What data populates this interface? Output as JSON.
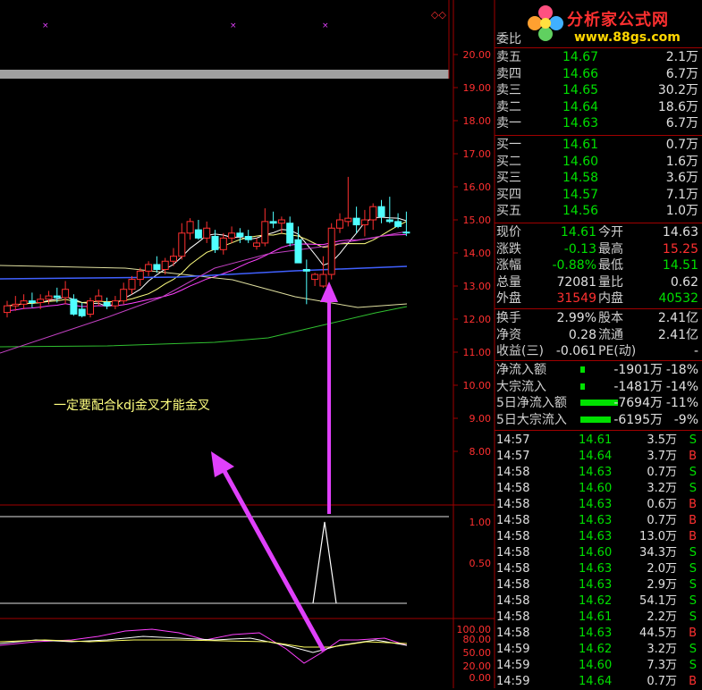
{
  "note": "一定要配合kdj金叉才能金叉",
  "logo": {
    "brand": "分析家公式网",
    "url": "www.88gs.com"
  },
  "price_axis": [
    "20.00",
    "19.00",
    "18.00",
    "17.00",
    "16.00",
    "15.00",
    "14.00",
    "13.00",
    "12.00",
    "11.00",
    "10.00",
    "9.00",
    "8.00"
  ],
  "ind1_axis": [
    "1.00",
    "0.50"
  ],
  "ind2_axis": [
    "100.00",
    "80.00",
    "50.00",
    "20.00",
    "0.00"
  ],
  "order_book": {
    "header": {
      "label": "委比",
      "value": ""
    },
    "asks": [
      {
        "label": "卖五",
        "price": "14.67",
        "vol": "2.1万"
      },
      {
        "label": "卖四",
        "price": "14.66",
        "vol": "6.7万"
      },
      {
        "label": "卖三",
        "price": "14.65",
        "vol": "30.2万"
      },
      {
        "label": "卖二",
        "price": "14.64",
        "vol": "18.6万"
      },
      {
        "label": "卖一",
        "price": "14.63",
        "vol": "6.7万"
      }
    ],
    "bids": [
      {
        "label": "买一",
        "price": "14.61",
        "vol": "0.7万"
      },
      {
        "label": "买二",
        "price": "14.60",
        "vol": "1.6万"
      },
      {
        "label": "买三",
        "price": "14.58",
        "vol": "3.6万"
      },
      {
        "label": "买四",
        "price": "14.57",
        "vol": "7.1万"
      },
      {
        "label": "买五",
        "price": "14.56",
        "vol": "1.0万"
      }
    ]
  },
  "quote": [
    {
      "l1": "现价",
      "v1": "14.61",
      "l2": "今开",
      "v2": "14.63"
    },
    {
      "l1": "涨跌",
      "v1": "-0.13",
      "l2": "最高",
      "v2": "15.25"
    },
    {
      "l1": "涨幅",
      "v1": "-0.88%",
      "l2": "最低",
      "v2": "14.51"
    },
    {
      "l1": "总量",
      "v1": "72081",
      "l2": "量比",
      "v2": "0.62"
    },
    {
      "l1": "外盘",
      "v1": "31549",
      "l2": "内盘",
      "v2": "40532"
    }
  ],
  "fundamentals": [
    {
      "l1": "换手",
      "v1": "2.99%",
      "l2": "股本",
      "v2": "2.41亿"
    },
    {
      "l1": "净资",
      "v1": "0.28",
      "l2": "流通",
      "v2": "2.41亿"
    },
    {
      "l1": "收益(三)",
      "v1": "-0.061",
      "l2": "PE(动)",
      "v2": "-"
    }
  ],
  "flows": [
    {
      "label": "净流入额",
      "value": "-1901万",
      "pct": "-18%",
      "bar": 0.04
    },
    {
      "label": "大宗流入",
      "value": "-1481万",
      "pct": "-14%",
      "bar": 0.04
    },
    {
      "label": "5日净流入额",
      "value": "-7694万",
      "pct": "-11%",
      "bar": 1.0
    },
    {
      "label": "5日大宗流入",
      "value": "-6195万",
      "pct": "-9%",
      "bar": 0.8
    }
  ],
  "ticks": [
    {
      "time": "14:57",
      "price": "14.61",
      "vol": "3.5万",
      "side": "S"
    },
    {
      "time": "14:57",
      "price": "14.64",
      "vol": "3.7万",
      "side": "B"
    },
    {
      "time": "14:58",
      "price": "14.63",
      "vol": "0.7万",
      "side": "S"
    },
    {
      "time": "14:58",
      "price": "14.60",
      "vol": "3.2万",
      "side": "S"
    },
    {
      "time": "14:58",
      "price": "14.63",
      "vol": "0.6万",
      "side": "B"
    },
    {
      "time": "14:58",
      "price": "14.63",
      "vol": "0.7万",
      "side": "B"
    },
    {
      "time": "14:58",
      "price": "14.63",
      "vol": "13.0万",
      "side": "B"
    },
    {
      "time": "14:58",
      "price": "14.60",
      "vol": "34.3万",
      "side": "S"
    },
    {
      "time": "14:58",
      "price": "14.63",
      "vol": "2.0万",
      "side": "S"
    },
    {
      "time": "14:58",
      "price": "14.63",
      "vol": "2.9万",
      "side": "S"
    },
    {
      "time": "14:58",
      "price": "14.62",
      "vol": "54.1万",
      "side": "S"
    },
    {
      "time": "14:58",
      "price": "14.61",
      "vol": "2.2万",
      "side": "S"
    },
    {
      "time": "14:58",
      "price": "14.63",
      "vol": "44.5万",
      "side": "B"
    },
    {
      "time": "14:59",
      "price": "14.62",
      "vol": "3.2万",
      "side": "S"
    },
    {
      "time": "14:59",
      "price": "14.60",
      "vol": "7.3万",
      "side": "S"
    },
    {
      "time": "14:59",
      "price": "14.64",
      "vol": "0.7万",
      "side": "B"
    }
  ],
  "colors": {
    "up": "#ff3030",
    "down": "#00e000",
    "neutral": "#e0e0e0",
    "accent": "#e040fb",
    "grid": "#a00000"
  },
  "candles": [
    {
      "o": 12.2,
      "h": 12.55,
      "l": 12.05,
      "c": 12.4
    },
    {
      "o": 12.4,
      "h": 12.7,
      "l": 12.25,
      "c": 12.45
    },
    {
      "o": 12.45,
      "h": 12.75,
      "l": 12.3,
      "c": 12.55
    },
    {
      "o": 12.55,
      "h": 12.8,
      "l": 12.35,
      "c": 12.5
    },
    {
      "o": 12.5,
      "h": 12.75,
      "l": 12.3,
      "c": 12.6
    },
    {
      "o": 12.6,
      "h": 12.85,
      "l": 12.45,
      "c": 12.7
    },
    {
      "o": 12.7,
      "h": 12.95,
      "l": 12.5,
      "c": 12.65
    },
    {
      "o": 12.65,
      "h": 13.15,
      "l": 12.45,
      "c": 12.9
    },
    {
      "o": 12.6,
      "h": 12.75,
      "l": 12.1,
      "c": 12.15
    },
    {
      "o": 12.3,
      "h": 12.5,
      "l": 12.05,
      "c": 12.1
    },
    {
      "o": 12.15,
      "h": 12.65,
      "l": 12.05,
      "c": 12.55
    },
    {
      "o": 12.55,
      "h": 12.9,
      "l": 12.4,
      "c": 12.7
    },
    {
      "o": 12.5,
      "h": 12.65,
      "l": 12.3,
      "c": 12.4
    },
    {
      "o": 12.4,
      "h": 12.7,
      "l": 12.3,
      "c": 12.55
    },
    {
      "o": 12.55,
      "h": 13.1,
      "l": 12.45,
      "c": 12.9
    },
    {
      "o": 12.9,
      "h": 13.3,
      "l": 12.75,
      "c": 13.2
    },
    {
      "o": 13.2,
      "h": 13.55,
      "l": 13.0,
      "c": 13.45
    },
    {
      "o": 13.45,
      "h": 13.75,
      "l": 13.3,
      "c": 13.65
    },
    {
      "o": 13.65,
      "h": 13.9,
      "l": 13.4,
      "c": 13.5
    },
    {
      "o": 13.5,
      "h": 13.85,
      "l": 13.35,
      "c": 13.75
    },
    {
      "o": 13.75,
      "h": 14.15,
      "l": 13.6,
      "c": 13.9
    },
    {
      "o": 13.9,
      "h": 14.9,
      "l": 13.8,
      "c": 14.6
    },
    {
      "o": 14.6,
      "h": 15.05,
      "l": 14.4,
      "c": 14.95
    },
    {
      "o": 14.7,
      "h": 15.0,
      "l": 14.4,
      "c": 14.45
    },
    {
      "o": 14.45,
      "h": 14.95,
      "l": 14.3,
      "c": 14.75
    },
    {
      "o": 14.5,
      "h": 14.7,
      "l": 14.0,
      "c": 14.1
    },
    {
      "o": 14.1,
      "h": 14.6,
      "l": 13.95,
      "c": 14.45
    },
    {
      "o": 14.45,
      "h": 14.8,
      "l": 14.3,
      "c": 14.6
    },
    {
      "o": 14.6,
      "h": 14.75,
      "l": 14.3,
      "c": 14.5
    },
    {
      "o": 14.5,
      "h": 14.7,
      "l": 14.3,
      "c": 14.4
    },
    {
      "o": 14.2,
      "h": 14.45,
      "l": 14.1,
      "c": 14.3
    },
    {
      "o": 14.3,
      "h": 15.35,
      "l": 14.2,
      "c": 14.95
    },
    {
      "o": 14.95,
      "h": 15.25,
      "l": 14.75,
      "c": 14.9
    },
    {
      "o": 14.9,
      "h": 15.1,
      "l": 14.6,
      "c": 15.0
    },
    {
      "o": 14.9,
      "h": 15.1,
      "l": 14.2,
      "c": 14.3
    },
    {
      "o": 14.4,
      "h": 14.8,
      "l": 13.7,
      "c": 13.7
    },
    {
      "o": 13.5,
      "h": 13.8,
      "l": 12.45,
      "c": 13.45
    },
    {
      "o": 13.2,
      "h": 13.4,
      "l": 13.0,
      "c": 13.35
    },
    {
      "o": 13.0,
      "h": 13.9,
      "l": 12.95,
      "c": 13.35
    },
    {
      "o": 13.35,
      "h": 14.9,
      "l": 13.2,
      "c": 14.75
    },
    {
      "o": 14.75,
      "h": 15.2,
      "l": 14.6,
      "c": 15.0
    },
    {
      "o": 14.95,
      "h": 16.3,
      "l": 14.8,
      "c": 15.05
    },
    {
      "o": 15.05,
      "h": 15.4,
      "l": 14.6,
      "c": 14.85
    },
    {
      "o": 14.85,
      "h": 15.3,
      "l": 14.5,
      "c": 15.0
    },
    {
      "o": 15.0,
      "h": 15.5,
      "l": 14.7,
      "c": 15.4
    },
    {
      "o": 15.4,
      "h": 15.6,
      "l": 14.9,
      "c": 15.1
    },
    {
      "o": 15.0,
      "h": 15.7,
      "l": 14.9,
      "c": 14.95
    },
    {
      "o": 14.95,
      "h": 15.2,
      "l": 14.75,
      "c": 14.8
    },
    {
      "o": 14.63,
      "h": 15.25,
      "l": 14.51,
      "c": 14.61
    }
  ]
}
